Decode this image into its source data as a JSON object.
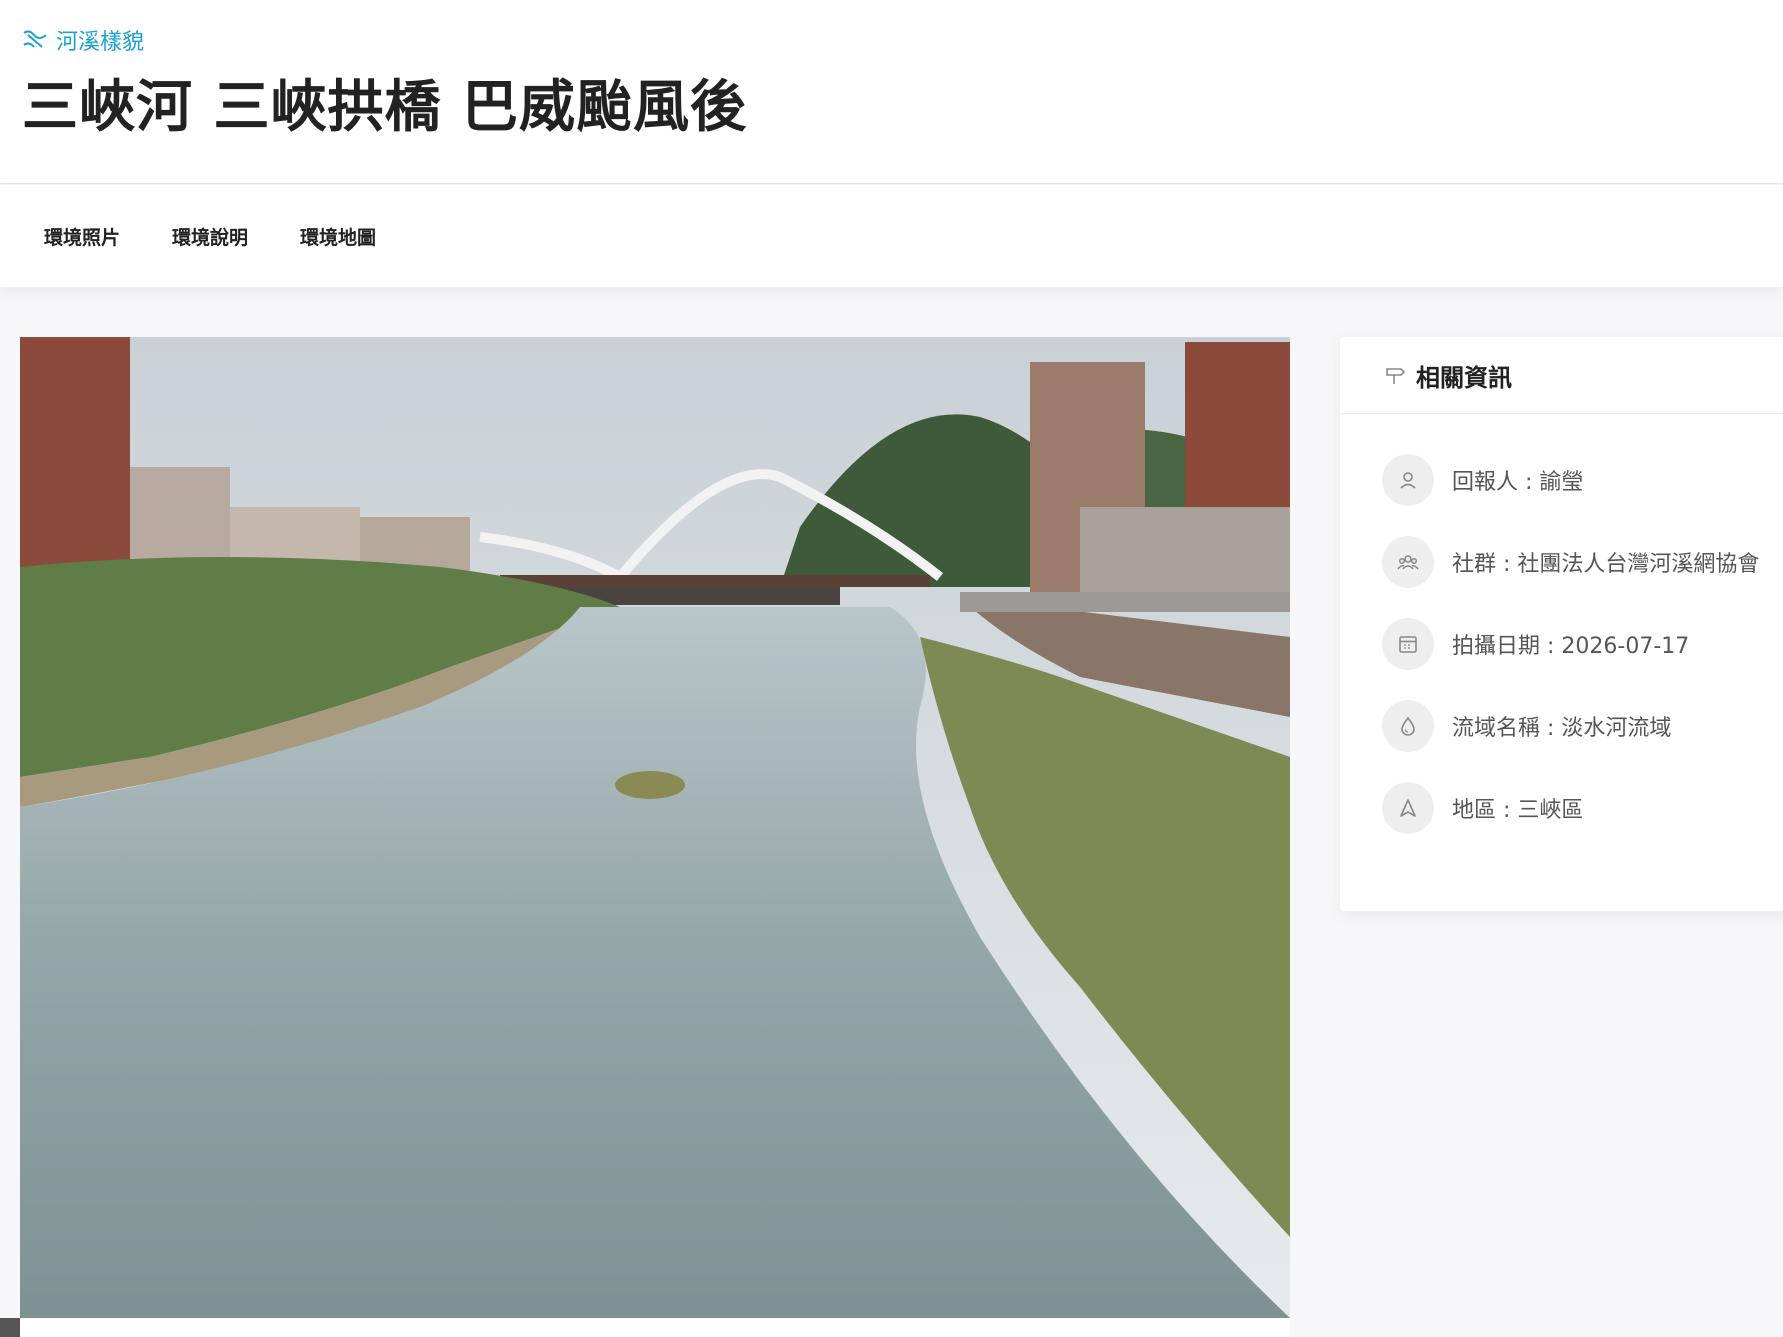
{
  "header": {
    "category": "河溪樣貌",
    "title": "三峽河 三峽拱橋 巴威颱風後"
  },
  "tabs": [
    {
      "label": "環境照片"
    },
    {
      "label": "環境說明"
    },
    {
      "label": "環境地圖"
    }
  ],
  "info": {
    "title": "相關資訊",
    "items": [
      {
        "icon": "user-icon",
        "text": "回報人 : 諭瑩"
      },
      {
        "icon": "group-icon",
        "text": "社群 : 社團法人台灣河溪網協會"
      },
      {
        "icon": "calendar-icon",
        "text": "拍攝日期 : 2026-07-17"
      },
      {
        "icon": "water-drop-icon",
        "text": "流域名稱 : 淡水河流域"
      },
      {
        "icon": "location-icon",
        "text": "地區 : 三峽區"
      }
    ]
  },
  "colors": {
    "accent": "#1aa0d8",
    "icon_gray": "#888888"
  }
}
